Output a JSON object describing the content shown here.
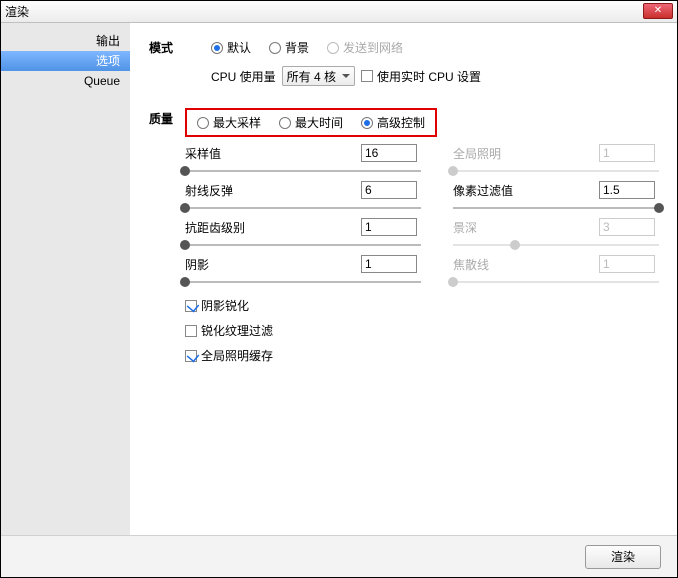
{
  "window": {
    "title": "渲染"
  },
  "sidebar": {
    "items": [
      {
        "label": "输出"
      },
      {
        "label": "选项"
      },
      {
        "label": "Queue"
      }
    ]
  },
  "mode": {
    "section_label": "模式",
    "options": {
      "default": "默认",
      "background": "背景",
      "network": "发送到网络"
    },
    "cpu_label": "CPU 使用量",
    "cpu_value": "所有 4 核",
    "realtime_label": "使用实时 CPU 设置"
  },
  "quality": {
    "section_label": "质量",
    "options": {
      "max_samples": "最大采样",
      "max_time": "最大时间",
      "advanced": "高级控制"
    },
    "params": {
      "samples": {
        "label": "采样值",
        "value": "16"
      },
      "gi": {
        "label": "全局照明",
        "value": "1"
      },
      "ray_bounce": {
        "label": "射线反弹",
        "value": "6"
      },
      "pixel_filter": {
        "label": "像素过滤值",
        "value": "1.5"
      },
      "aa": {
        "label": "抗距齿级别",
        "value": "1"
      },
      "dof": {
        "label": "景深",
        "value": "3"
      },
      "shadow": {
        "label": "阴影",
        "value": "1"
      },
      "caustics": {
        "label": "焦散线",
        "value": "1"
      }
    },
    "checks": {
      "shadow_sharpen": "阴影锐化",
      "sharpen_texture": "锐化纹理过滤",
      "gi_cache": "全局照明缓存"
    }
  },
  "footer": {
    "render": "渲染"
  }
}
